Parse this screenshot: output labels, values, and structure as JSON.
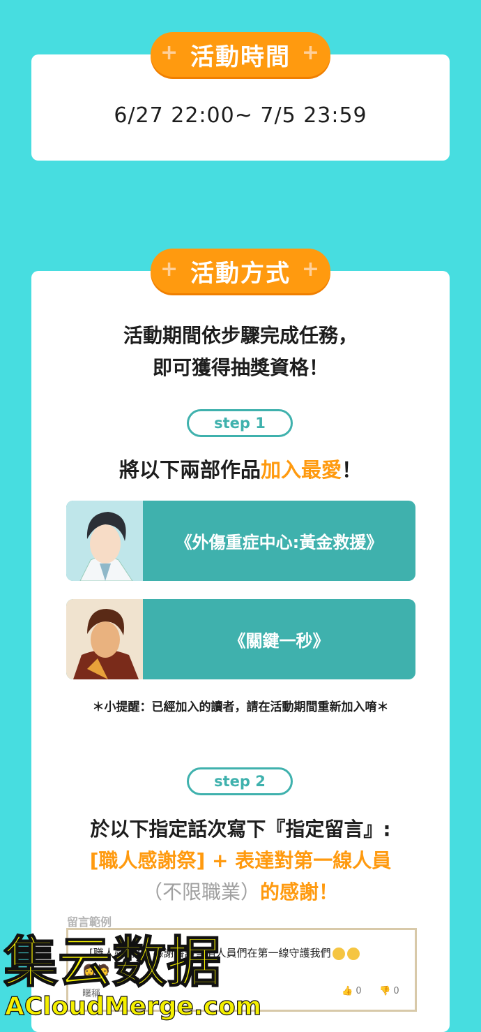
{
  "colors": {
    "background": "#47dde0",
    "accent_orange": "#ff9a0f",
    "teal": "#3fb1ad"
  },
  "section_time": {
    "header": "活動時間",
    "plus": "+",
    "date_range": "6/27 22:00~ 7/5 23:59"
  },
  "section_method": {
    "header": "活動方式",
    "intro_line1": "活動期間依步驟完成任務，",
    "intro_line2": "即可獲得抽獎資格！",
    "step1": {
      "badge": "step 1",
      "title_prefix": "將以下兩部作品",
      "title_highlight": "加入最愛",
      "title_suffix": "！",
      "works": [
        {
          "title": "《外傷重症中心:黃金救援》",
          "thumb_icon": "doctor-portrait"
        },
        {
          "title": "《關鍵一秒》",
          "thumb_icon": "firefighter-portrait"
        }
      ],
      "reminder": "＊小提醒：已經加入的讀者，請在活動期間重新加入唷＊"
    },
    "step2": {
      "badge": "step 2",
      "line1": "於以下指定話次寫下『指定留言』:",
      "line2": "[職人感謝祭] + 表達對第一線人員",
      "line3_grey": "（不限職業）",
      "line3_orange": "的感謝！",
      "example_label": "留言範例",
      "example_comment": "[職人感謝祭] 感謝醫護警消人員們在第一線守護我們",
      "example_user": "暱稱",
      "likes": "0",
      "dislikes": "0"
    }
  },
  "watermark": {
    "line1": "集云数据",
    "line2": "ACloudMerge.com"
  }
}
